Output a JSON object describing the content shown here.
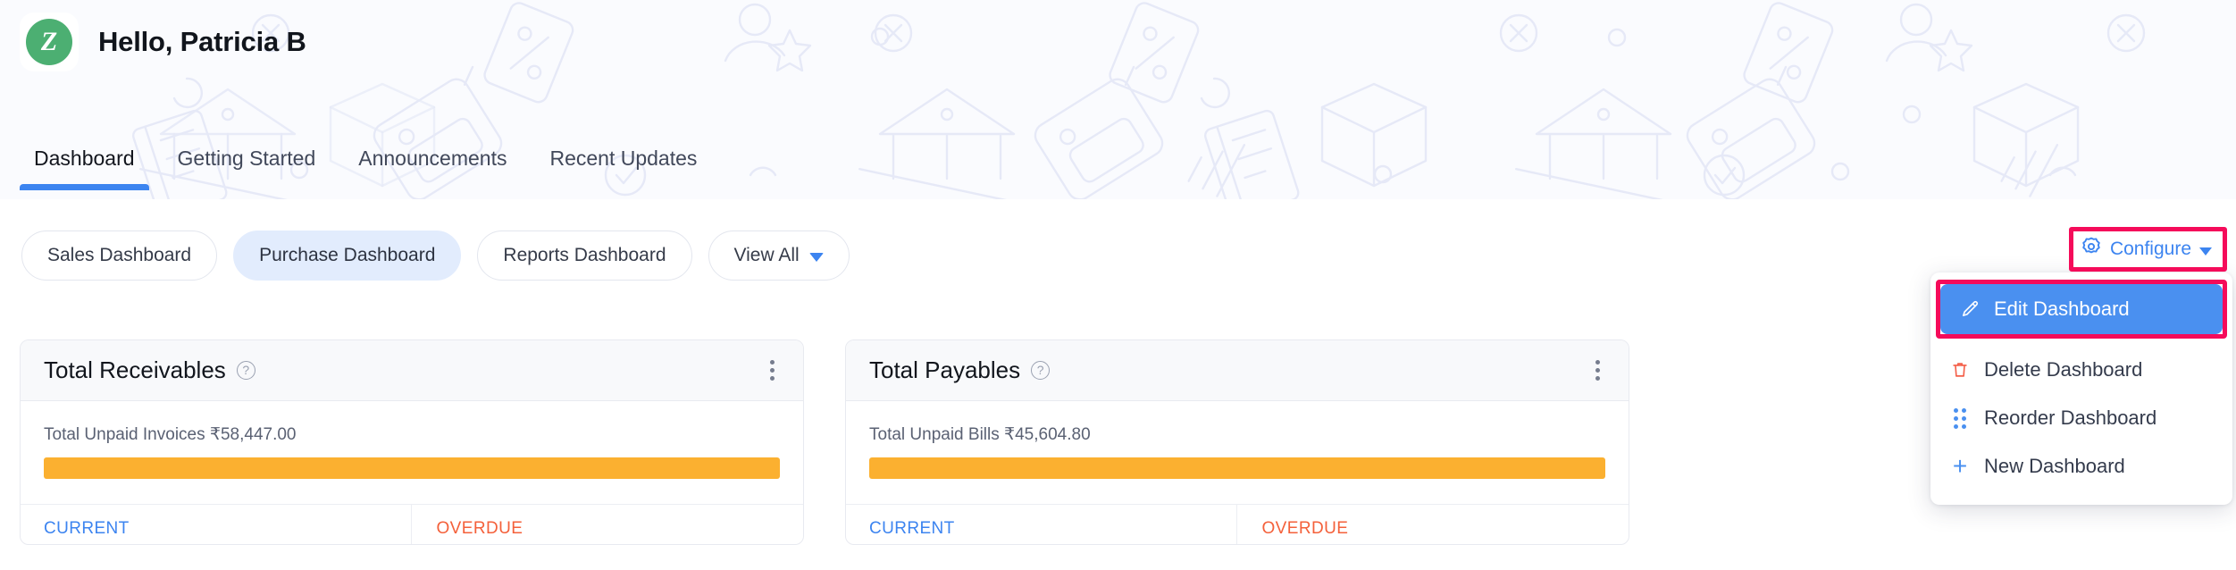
{
  "header": {
    "avatar_letter": "Z",
    "greeting": "Hello, Patricia B",
    "tabs": [
      {
        "label": "Dashboard",
        "active": true
      },
      {
        "label": "Getting Started",
        "active": false
      },
      {
        "label": "Announcements",
        "active": false
      },
      {
        "label": "Recent Updates",
        "active": false
      }
    ]
  },
  "dashboard_switcher": {
    "pills": [
      {
        "label": "Sales Dashboard",
        "active": false
      },
      {
        "label": "Purchase Dashboard",
        "active": true
      },
      {
        "label": "Reports Dashboard",
        "active": false
      }
    ],
    "view_all_label": "View All"
  },
  "configure": {
    "label": "Configure",
    "icon": "gear-icon",
    "menu_items": [
      {
        "label": "Edit Dashboard",
        "icon": "pencil-icon",
        "highlighted": true
      },
      {
        "label": "Delete Dashboard",
        "icon": "trash-icon",
        "highlighted": false
      },
      {
        "label": "Reorder Dashboard",
        "icon": "drag-dots-icon",
        "highlighted": false
      },
      {
        "label": "New Dashboard",
        "icon": "plus-icon",
        "highlighted": false
      }
    ]
  },
  "cards": [
    {
      "title": "Total Receivables",
      "help_icon": "help-circle-icon",
      "menu_icon": "kebab-menu-icon",
      "summary_label": "Total Unpaid Invoices ₹58,447.00",
      "bar_percent": "100",
      "columns": [
        {
          "label": "CURRENT",
          "tone": "current"
        },
        {
          "label": "OVERDUE",
          "tone": "overdue"
        }
      ]
    },
    {
      "title": "Total Payables",
      "help_icon": "help-circle-icon",
      "menu_icon": "kebab-menu-icon",
      "summary_label": "Total Unpaid Bills ₹45,604.80",
      "bar_percent": "100",
      "columns": [
        {
          "label": "CURRENT",
          "tone": "current"
        },
        {
          "label": "OVERDUE",
          "tone": "overdue"
        }
      ]
    }
  ],
  "colors": {
    "accent_blue": "#3c84f0",
    "highlight_blue": "#4a90f0",
    "annotation_red": "#f50b5a",
    "bar_orange": "#fbb030",
    "overdue_orange": "#f4603a",
    "avatar_green": "#4caf72",
    "header_bg": "#fafbfe"
  }
}
